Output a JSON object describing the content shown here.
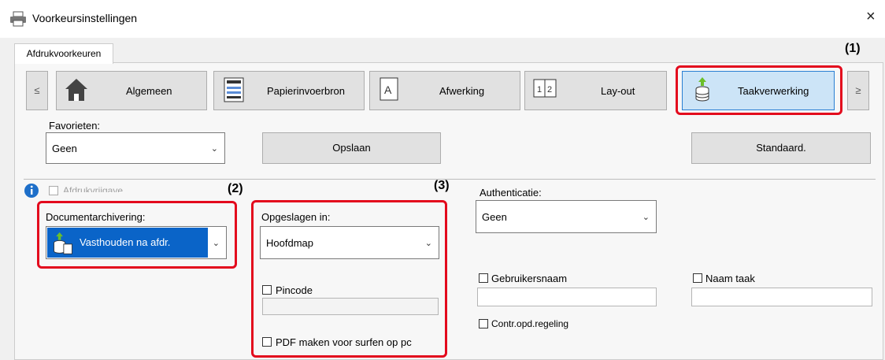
{
  "window": {
    "title": "Voorkeursinstellingen",
    "close": "×"
  },
  "tab": {
    "label": "Afdrukvoorkeuren"
  },
  "nav": {
    "prev": "≤",
    "next": "≥",
    "items": [
      {
        "label": "Algemeen",
        "icon": "home-icon"
      },
      {
        "label": "Papierinvoerbron",
        "icon": "paper-tray-icon"
      },
      {
        "label": "Afwerking",
        "icon": "finishing-icon"
      },
      {
        "label": "Lay-out",
        "icon": "layout-icon"
      },
      {
        "label": "Taakverwerking",
        "icon": "job-handling-icon",
        "selected": true
      }
    ]
  },
  "callouts": {
    "one": "(1)",
    "two": "(2)",
    "three": "(3)"
  },
  "favorites": {
    "label": "Favorieten:",
    "value": "Geen",
    "save": "Opslaan",
    "default": "Standaard."
  },
  "print_release": {
    "label": "Afdrukvrijgave"
  },
  "doc_archiving": {
    "label": "Documentarchivering:",
    "value": "Vasthouden na afdr."
  },
  "stored_in": {
    "label": "Opgeslagen in:",
    "value": "Hoofdmap",
    "pincode": "Pincode",
    "pdf": "PDF maken voor surfen op pc"
  },
  "auth": {
    "label": "Authenticatie:",
    "value": "Geen"
  },
  "username": {
    "label": "Gebruikersnaam"
  },
  "jobname": {
    "label": "Naam taak"
  },
  "contr": {
    "label": "Contr.opd.regeling"
  },
  "colors": {
    "accent": "#0a64c8",
    "callout": "#e30a1d",
    "selected_bg": "#cce4f7"
  }
}
